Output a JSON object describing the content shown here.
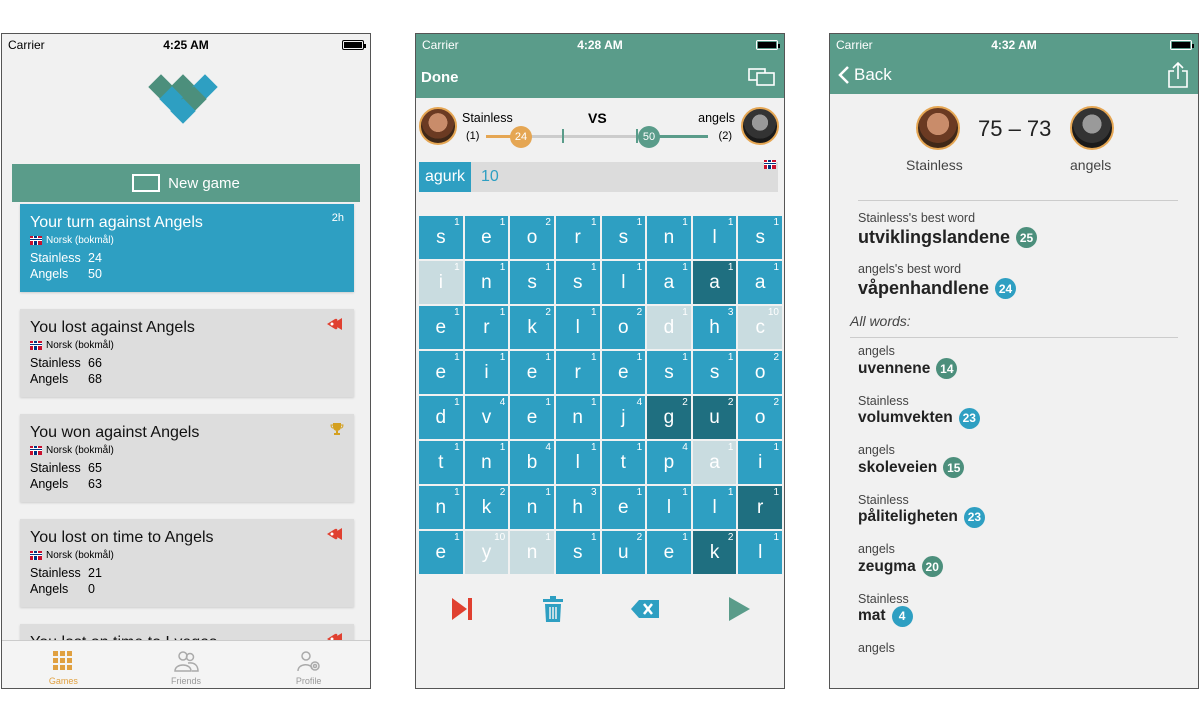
{
  "status": {
    "carrier": "Carrier",
    "times": [
      "4:25 AM",
      "4:28 AM",
      "4:32 AM"
    ]
  },
  "colors": {
    "teal": "#5a9c8a",
    "blue": "#2e9fc2",
    "dark_blue": "#1f6f80",
    "orange": "#e5a653",
    "red": "#e04030"
  },
  "games_screen": {
    "new_game_label": "New game",
    "games": [
      {
        "title": "Your turn against Angels",
        "language": "Norsk (bokmål)",
        "p1": "Stainless",
        "s1": "24",
        "p2": "Angels",
        "s2": "50",
        "badge": "2h",
        "badge_icon": "",
        "active": true
      },
      {
        "title": "You lost against Angels",
        "language": "Norsk (bokmål)",
        "p1": "Stainless",
        "s1": "66",
        "p2": "Angels",
        "s2": "68",
        "badge": "",
        "badge_icon": "horn-icon",
        "active": false
      },
      {
        "title": "You won against Angels",
        "language": "Norsk (bokmål)",
        "p1": "Stainless",
        "s1": "65",
        "p2": "Angels",
        "s2": "63",
        "badge": "",
        "badge_icon": "trophy-icon",
        "active": false
      },
      {
        "title": "You lost on time to  Angels",
        "language": "Norsk (bokmål)",
        "p1": "Stainless",
        "s1": "21",
        "p2": "Angels",
        "s2": "0",
        "badge": "",
        "badge_icon": "horn-icon",
        "active": false
      },
      {
        "title": "You lost on time to  Lvegas",
        "language": "",
        "p1": "",
        "s1": "",
        "p2": "",
        "s2": "",
        "badge": "",
        "badge_icon": "horn-icon",
        "active": false
      }
    ],
    "tabs": [
      {
        "label": "Games",
        "icon": "grid-icon",
        "selected": true
      },
      {
        "label": "Friends",
        "icon": "friends-icon",
        "selected": false
      },
      {
        "label": "Profile",
        "icon": "profile-gear-icon",
        "selected": false
      }
    ]
  },
  "board_screen": {
    "done_label": "Done",
    "vs_label": "VS",
    "player1": {
      "name": "Stainless",
      "rank": "(1)",
      "score": "24"
    },
    "player2": {
      "name": "angels",
      "rank": "(2)",
      "score": "50"
    },
    "current_word": "agurk",
    "current_points": "10",
    "board": [
      [
        [
          "s",
          "1",
          ""
        ],
        [
          "e",
          "1",
          ""
        ],
        [
          "o",
          "2",
          ""
        ],
        [
          "r",
          "1",
          ""
        ],
        [
          "s",
          "1",
          ""
        ],
        [
          "n",
          "1",
          ""
        ],
        [
          "l",
          "1",
          ""
        ],
        [
          "s",
          "1",
          ""
        ]
      ],
      [
        [
          "i",
          "1",
          "light"
        ],
        [
          "n",
          "1",
          ""
        ],
        [
          "s",
          "1",
          ""
        ],
        [
          "s",
          "1",
          ""
        ],
        [
          "l",
          "1",
          ""
        ],
        [
          "a",
          "1",
          ""
        ],
        [
          "a",
          "1",
          "dark"
        ],
        [
          "a",
          "1",
          ""
        ]
      ],
      [
        [
          "e",
          "1",
          ""
        ],
        [
          "r",
          "1",
          ""
        ],
        [
          "k",
          "2",
          ""
        ],
        [
          "l",
          "1",
          ""
        ],
        [
          "o",
          "2",
          ""
        ],
        [
          "d",
          "1",
          "light"
        ],
        [
          "h",
          "3",
          ""
        ],
        [
          "c",
          "10",
          "light"
        ]
      ],
      [
        [
          "e",
          "1",
          ""
        ],
        [
          "i",
          "1",
          ""
        ],
        [
          "e",
          "1",
          ""
        ],
        [
          "r",
          "1",
          ""
        ],
        [
          "e",
          "1",
          ""
        ],
        [
          "s",
          "1",
          ""
        ],
        [
          "s",
          "1",
          ""
        ],
        [
          "o",
          "2",
          ""
        ]
      ],
      [
        [
          "d",
          "1",
          ""
        ],
        [
          "v",
          "4",
          ""
        ],
        [
          "e",
          "1",
          ""
        ],
        [
          "n",
          "1",
          ""
        ],
        [
          "j",
          "4",
          ""
        ],
        [
          "g",
          "2",
          "dark"
        ],
        [
          "u",
          "2",
          "dark"
        ],
        [
          "o",
          "2",
          ""
        ]
      ],
      [
        [
          "t",
          "1",
          ""
        ],
        [
          "n",
          "1",
          ""
        ],
        [
          "b",
          "4",
          ""
        ],
        [
          "l",
          "1",
          ""
        ],
        [
          "t",
          "1",
          ""
        ],
        [
          "p",
          "4",
          ""
        ],
        [
          "a",
          "1",
          "light"
        ],
        [
          "i",
          "1",
          ""
        ]
      ],
      [
        [
          "n",
          "1",
          ""
        ],
        [
          "k",
          "2",
          ""
        ],
        [
          "n",
          "1",
          ""
        ],
        [
          "h",
          "3",
          ""
        ],
        [
          "e",
          "1",
          ""
        ],
        [
          "l",
          "1",
          ""
        ],
        [
          "l",
          "1",
          ""
        ],
        [
          "r",
          "1",
          "dark"
        ]
      ],
      [
        [
          "e",
          "1",
          ""
        ],
        [
          "y",
          "10",
          "light"
        ],
        [
          "n",
          "1",
          "light"
        ],
        [
          "s",
          "1",
          ""
        ],
        [
          "u",
          "2",
          ""
        ],
        [
          "e",
          "1",
          ""
        ],
        [
          "k",
          "2",
          "dark"
        ],
        [
          "l",
          "1",
          ""
        ]
      ]
    ]
  },
  "result_screen": {
    "back_label": "Back",
    "score": "75 – 73",
    "player1": "Stainless",
    "player2": "angels",
    "best_words": [
      {
        "label": "Stainless's best word",
        "word": "utviklingslandene",
        "points": "25",
        "pill": "g"
      },
      {
        "label": "angels's best word",
        "word": "våpenhandlene",
        "points": "24",
        "pill": "b"
      }
    ],
    "all_words_label": "All words:",
    "words": [
      {
        "player": "angels",
        "word": "uvennene",
        "points": "14",
        "pill": "g"
      },
      {
        "player": "Stainless",
        "word": "volumvekten",
        "points": "23",
        "pill": "b"
      },
      {
        "player": "angels",
        "word": "skoleveien",
        "points": "15",
        "pill": "g"
      },
      {
        "player": "Stainless",
        "word": "påliteligheten",
        "points": "23",
        "pill": "b"
      },
      {
        "player": "angels",
        "word": "zeugma",
        "points": "20",
        "pill": "g"
      },
      {
        "player": "Stainless",
        "word": "mat",
        "points": "4",
        "pill": "b"
      },
      {
        "player": "angels",
        "word": "",
        "points": "",
        "pill": "g"
      }
    ]
  }
}
